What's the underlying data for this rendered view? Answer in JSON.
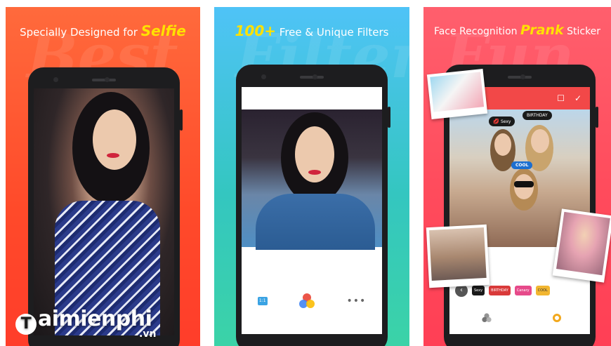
{
  "panels": [
    {
      "ghost": "Best",
      "headline_prefix": "Specially Designed for ",
      "headline_highlight": "Selfie",
      "headline_suffix": ""
    },
    {
      "ghost": "Filter",
      "headline_prefix": "",
      "headline_highlight": "100+",
      "headline_suffix": " Free & Unique Filters",
      "tools": {
        "crop_label": "1:1",
        "more": "•••"
      }
    },
    {
      "ghost": "Fun",
      "headline_prefix": "Face Recognition ",
      "headline_highlight": "Prank",
      "headline_suffix": " Sticker",
      "topbar": {
        "frame_icon": "☐",
        "confirm_icon": "✓"
      },
      "stickers": {
        "sexy": "Sexy",
        "birthday": "BIRTHDAY",
        "cool": "COOL"
      },
      "strip": {
        "back": "‹",
        "chips": [
          "Sexy",
          "BIRTHDAY",
          "Canary",
          "COOL"
        ]
      }
    }
  ],
  "watermark": {
    "logo_letter": "T",
    "text": "aimienphi",
    "sub": ".vn"
  },
  "colors": {
    "selfie_panel": "#ff4a2a",
    "filters_panel": "#34c6c0",
    "stickers_panel": "#ff4b5c",
    "highlight": "#ffe100"
  }
}
